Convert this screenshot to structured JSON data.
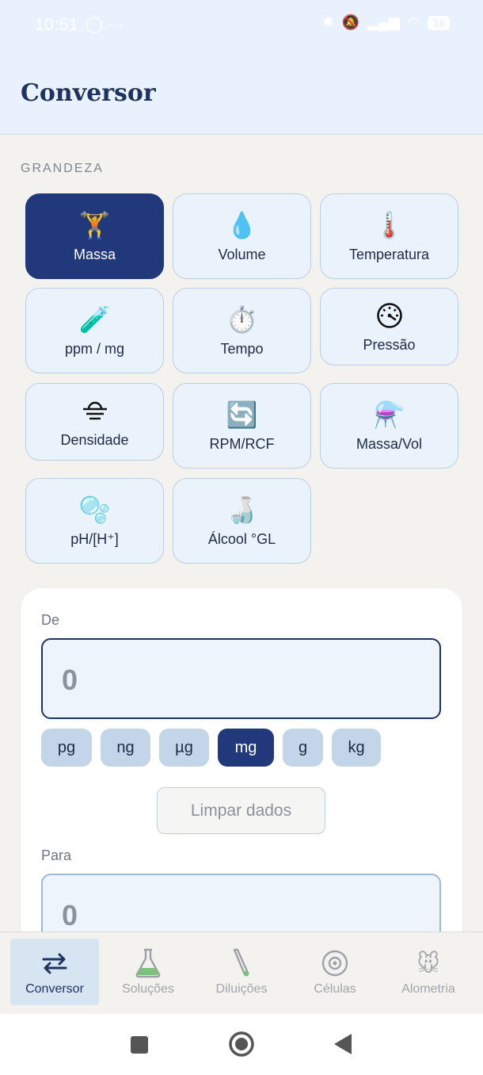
{
  "status_bar": {
    "time": "10:51",
    "left_icons": "◯ ···",
    "battery": "36"
  },
  "app": {
    "title": "Conversor"
  },
  "section": {
    "label": "GRANDEZA"
  },
  "quantities": [
    {
      "label": "Massa",
      "icon": "🏋️",
      "icon_name": "weightlifter-icon"
    },
    {
      "label": "Volume",
      "icon": "💧",
      "icon_name": "droplet-icon"
    },
    {
      "label": "Temperatura",
      "icon": "🌡️",
      "icon_name": "thermometer-icon"
    },
    {
      "label": "ppm / mg",
      "icon": "🧪",
      "icon_name": "test-tube-icon"
    },
    {
      "label": "Tempo",
      "icon": "⏱️",
      "icon_name": "stopwatch-icon"
    },
    {
      "label": "Pressão",
      "icon": "",
      "icon_name": "gauge-icon"
    },
    {
      "label": "Densidade",
      "icon": "",
      "icon_name": "density-icon"
    },
    {
      "label": "RPM/RCF",
      "icon": "🔄",
      "icon_name": "rotate-icon"
    },
    {
      "label": "Massa/Vol",
      "icon": "⚗️",
      "icon_name": "flask-icon"
    },
    {
      "label": "pH/[H⁺]",
      "icon": "🫧",
      "icon_name": "bubbles-icon"
    },
    {
      "label": "Álcool °GL",
      "icon": "🍶",
      "icon_name": "sake-bottle-icon"
    }
  ],
  "selected_quantity": "Massa",
  "converter": {
    "from_label": "De",
    "from_value": "0",
    "to_label": "Para",
    "to_value": "0",
    "units": [
      "pg",
      "ng",
      "µg",
      "mg",
      "g",
      "kg"
    ],
    "selected_unit": "mg",
    "clear_label": "Limpar dados"
  },
  "nav": [
    {
      "label": "Conversor",
      "icon_name": "swap-arrows-icon",
      "active": true
    },
    {
      "label": "Soluções",
      "icon_name": "flask-icon",
      "active": false
    },
    {
      "label": "Diluições",
      "icon_name": "pipette-icon",
      "active": false
    },
    {
      "label": "Células",
      "icon_name": "cell-icon",
      "active": false
    },
    {
      "label": "Alometria",
      "icon_name": "mouse-icon",
      "active": false
    }
  ],
  "colors": {
    "primary": "#21397a",
    "header_bg": "#e9f2fc",
    "tile_bg": "#eaf3fb",
    "chip_bg": "#c3d5e8"
  }
}
